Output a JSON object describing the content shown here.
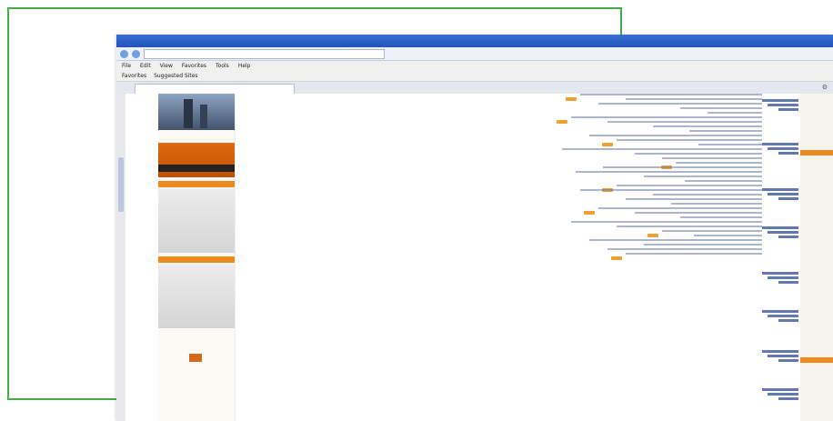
{
  "window": {
    "title": "",
    "address": "",
    "tab_title": ""
  },
  "menu": {
    "items": [
      "File",
      "Edit",
      "View",
      "Favorites",
      "Tools",
      "Help"
    ]
  },
  "favorites_bar": {
    "items": [
      "Favorites",
      "Suggested Sites"
    ]
  },
  "colors": {
    "frame_outline": "#3fae49",
    "titlebar": "#2354b9",
    "accent_orange": "#ef8a1f",
    "link_blue": "#1f3f8f"
  },
  "icons": [
    "back-icon",
    "forward-icon",
    "home-icon",
    "page-icon",
    "tools-icon"
  ]
}
